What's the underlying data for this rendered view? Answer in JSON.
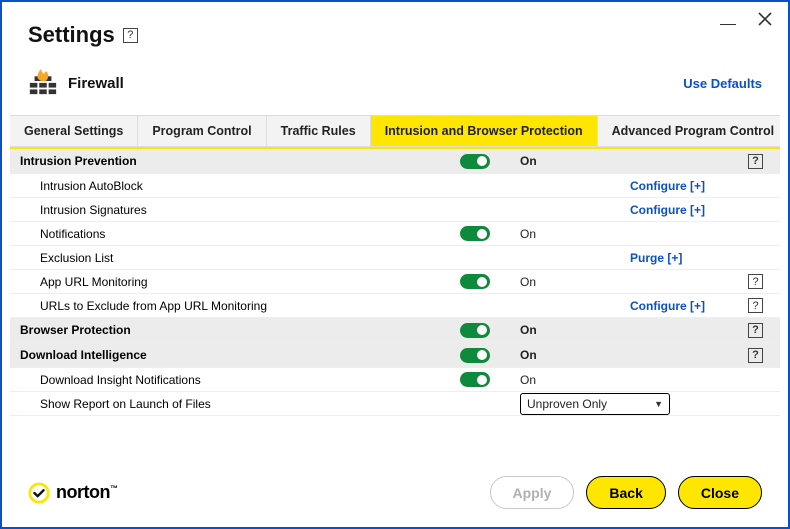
{
  "window": {
    "title": "Settings"
  },
  "subheader": {
    "title": "Firewall",
    "use_defaults": "Use Defaults"
  },
  "tabs": [
    {
      "label": "General Settings"
    },
    {
      "label": "Program Control"
    },
    {
      "label": "Traffic Rules"
    },
    {
      "label": "Intrusion and Browser Protection",
      "active": true
    },
    {
      "label": "Advanced Program Control"
    }
  ],
  "states": {
    "on": "On"
  },
  "actions": {
    "configure": "Configure [+]",
    "purge": "Purge [+]"
  },
  "select": {
    "show_report": "Unproven Only"
  },
  "sections": {
    "intrusion_prevention": {
      "label": "Intrusion Prevention",
      "rows": {
        "autoblock": "Intrusion AutoBlock",
        "signatures": "Intrusion Signatures",
        "notifications": "Notifications",
        "exclusion": "Exclusion List",
        "app_url": "App URL Monitoring",
        "urls_exclude": "URLs to Exclude from App URL Monitoring"
      }
    },
    "browser_protection": {
      "label": "Browser Protection"
    },
    "download_intelligence": {
      "label": "Download Intelligence",
      "rows": {
        "insight_notifications": "Download Insight Notifications",
        "show_report": "Show Report on Launch of Files"
      }
    }
  },
  "footer": {
    "brand": "norton",
    "apply": "Apply",
    "back": "Back",
    "close": "Close"
  }
}
